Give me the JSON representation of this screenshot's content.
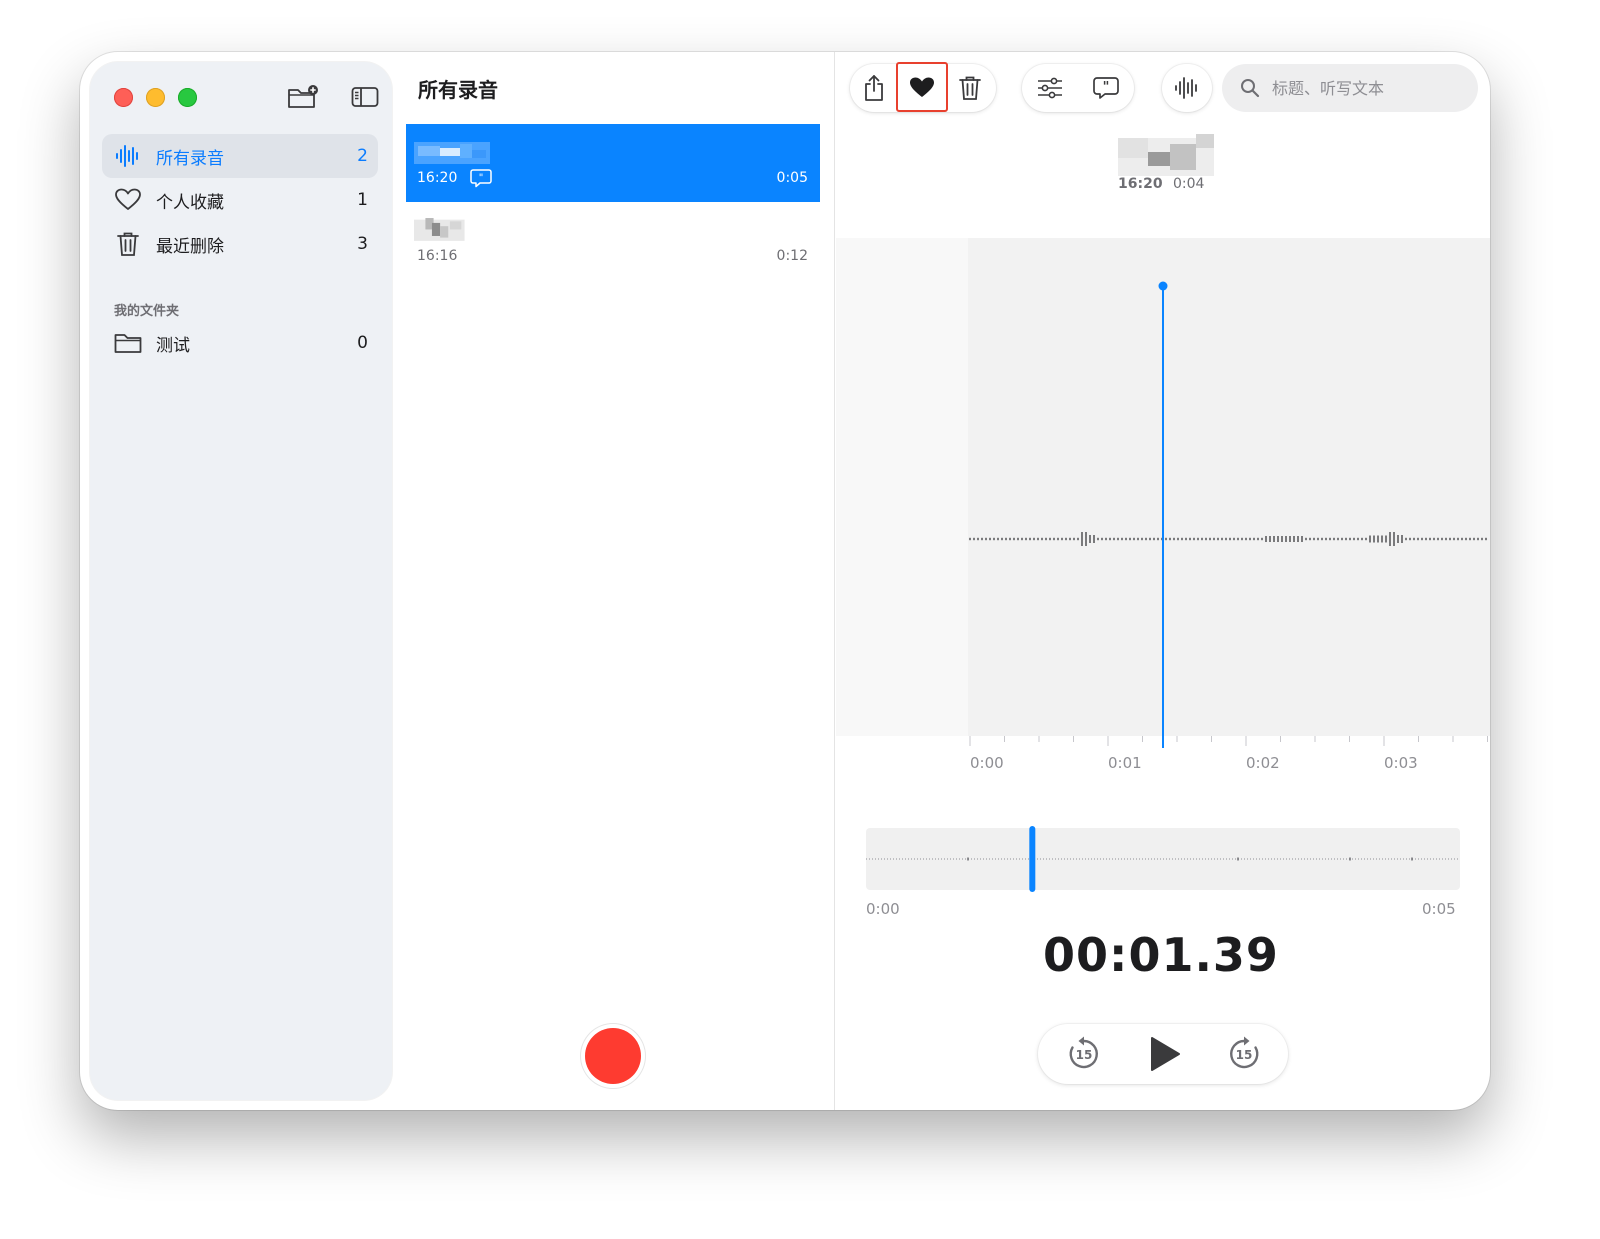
{
  "window": {
    "title": "所有录音"
  },
  "sidebar": {
    "items": [
      {
        "label": "所有录音",
        "count": "2",
        "icon": "waveform-icon",
        "selected": true
      },
      {
        "label": "个人收藏",
        "count": "1",
        "icon": "heart-icon"
      },
      {
        "label": "最近删除",
        "count": "3",
        "icon": "trash-icon"
      }
    ],
    "section_title": "我的文件夹",
    "folders": [
      {
        "label": "测试",
        "count": "0",
        "icon": "folder-icon"
      }
    ],
    "new_folder_icon": "new-folder-icon",
    "toggle_sidebar_icon": "sidebar-toggle-icon"
  },
  "list": {
    "title": "所有录音",
    "recordings": [
      {
        "time": "16:20",
        "duration": "0:05",
        "has_transcript": true,
        "selected": true
      },
      {
        "time": "16:16",
        "duration": "0:12"
      }
    ],
    "record_button": "record-icon"
  },
  "toolbar": {
    "share_icon": "share-icon",
    "favorite_icon": "heart-filled-icon",
    "delete_icon": "trash-icon",
    "options_icon": "sliders-icon",
    "transcript_icon": "transcript-icon",
    "enhance_icon": "waveform-icon",
    "search_placeholder": "标题、听写文本"
  },
  "detail": {
    "time": "16:20",
    "duration": "0:04",
    "timeline_labels": [
      "0:00",
      "0:01",
      "0:02",
      "0:03"
    ],
    "mini_start": "0:00",
    "mini_end": "0:05",
    "playhead_position": "00:01.39",
    "mini_progress_fraction": 0.28,
    "skip_back_label": "15",
    "skip_forward_label": "15"
  },
  "colors": {
    "accent": "#0a84ff",
    "record": "#fe3b30",
    "highlight_box": "#e8402e"
  }
}
